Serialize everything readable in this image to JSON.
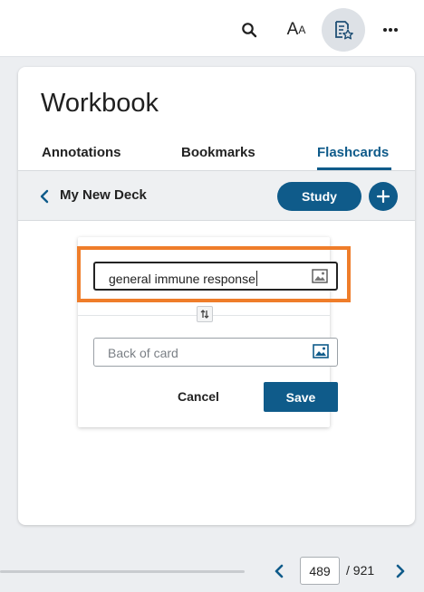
{
  "toolbar": {
    "search_icon": "search-icon",
    "text_size_label_big": "A",
    "text_size_label_small": "A",
    "workbook_icon": "workbook-icon",
    "more_icon": "more-icon"
  },
  "workbook": {
    "title": "Workbook",
    "tabs": [
      {
        "label": "Annotations",
        "active": false
      },
      {
        "label": "Bookmarks",
        "active": false
      },
      {
        "label": "Flashcards",
        "active": true
      }
    ],
    "deck": {
      "name": "My New Deck",
      "study_label": "Study"
    },
    "card": {
      "front_value": "general immune response",
      "back_placeholder": "Back of card",
      "cancel_label": "Cancel",
      "save_label": "Save"
    }
  },
  "pager": {
    "current_page": "489",
    "total": "/ 921"
  },
  "colors": {
    "accent": "#0f5b8a",
    "highlight": "#ef7d2a"
  }
}
